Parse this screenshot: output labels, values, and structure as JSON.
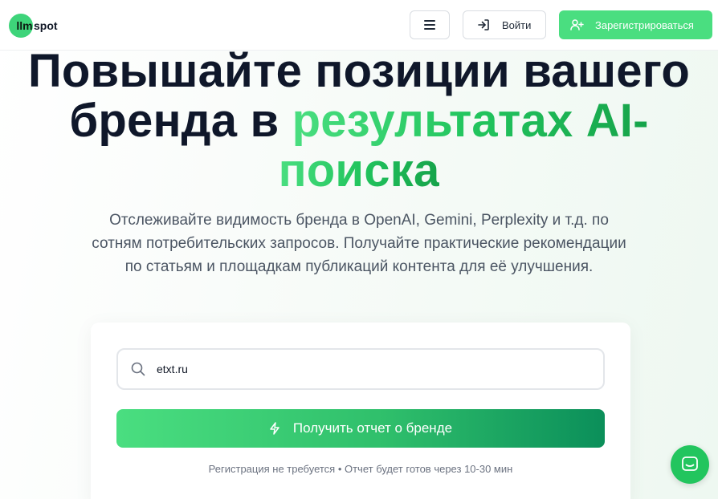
{
  "brand": {
    "logo_badge": "llm",
    "logo_text": "spot"
  },
  "header": {
    "login_label": "Войти",
    "register_label": "Зарегистрироваться"
  },
  "hero": {
    "title_line1": "Повышайте позиции вашего",
    "title_line2_prefix": "бренда в ",
    "title_accent_line2": "результатах AI-",
    "title_accent_line3": "поиска",
    "subtitle": "Отслеживайте видимость бренда в OpenAI, Gemini, Perplexity и т.д. по сотням потребительских запросов. Получайте практические рекомендации по статьям и площадкам публикаций контента для её улучшения."
  },
  "form": {
    "domain_value": "etxt.ru",
    "submit_label": "Получить отчет о бренде",
    "note": "Регистрация не требуется • Отчет будет готов через 10-30 мин"
  },
  "colors": {
    "accent": "#4ade80",
    "accent_dark": "#0b8f5a",
    "text": "#0f172a"
  },
  "icons": {
    "menu": "menu-icon",
    "login": "login-icon",
    "register": "user-plus-icon",
    "search": "search-icon",
    "cta": "lightning-icon",
    "chat": "chat-icon"
  }
}
